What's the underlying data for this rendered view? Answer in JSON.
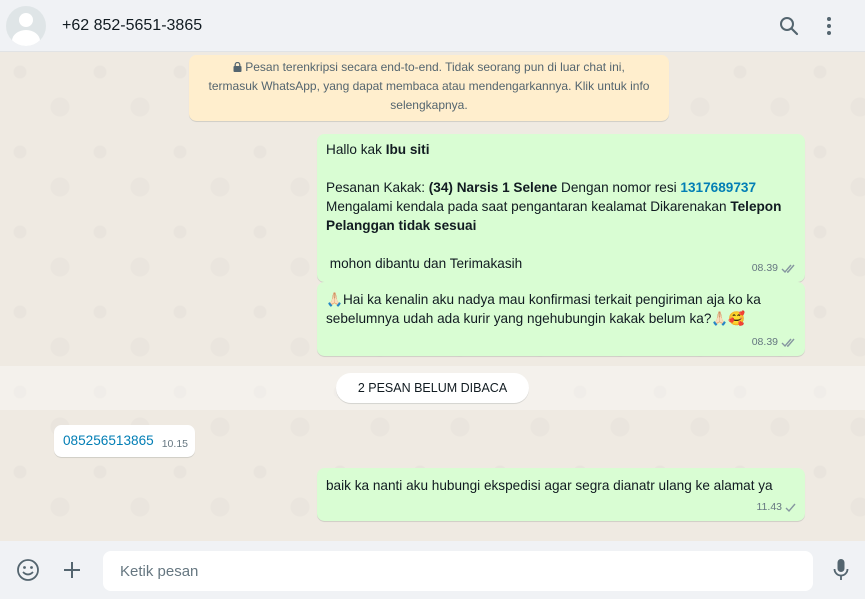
{
  "header": {
    "contact_name": "+62 852-5651-3865",
    "icons": [
      "search-icon",
      "menu-dots-icon"
    ]
  },
  "encryption_notice": {
    "line1": "Pesan terenkripsi secara end-to-end. Tidak seorang pun di luar chat ini,",
    "line2": "termasuk WhatsApp, yang dapat membaca atau mendengarkannya. Klik untuk info",
    "line3": "selengkapnya."
  },
  "messages": [
    {
      "direction": "outgoing",
      "greeting_prefix": "Hallo kak ",
      "greeting_name": "Ibu siti",
      "order_prefix": "Pesanan Kakak: ",
      "order_item": "(34) Narsis 1 Selene",
      "order_middle": " Dengan nomor resi ",
      "receipt_number": "1317689737",
      "issue_text": "Mengalami kendala pada saat pengantaran kealamat Dikarenakan ",
      "issue_bold_1": "Telepon",
      "issue_bold_2": "Pelanggan tidak sesuai",
      "closing": " mohon dibantu dan Terimakasih",
      "time": "08.39",
      "status": "double-check"
    },
    {
      "direction": "outgoing",
      "emoji_start": "🙏🏻",
      "line1": "Hai ka kenalin aku nadya mau konfirmasi terkait pengiriman aja ko ka",
      "line2": "sebelumnya udah ada kurir yang ngehubungin kakak belum ka?",
      "emoji_end": "🙏🏻🥰",
      "time": "08.39",
      "status": "double-check"
    },
    {
      "direction": "incoming",
      "text": "085256513865",
      "time": "10.15"
    },
    {
      "direction": "outgoing",
      "text": "baik ka nanti aku hubungi ekspedisi agar segra dianatr ulang ke alamat ya",
      "time": "11.43",
      "status": "single-check"
    }
  ],
  "unread_divider": "2 PESAN BELUM DIBACA",
  "composer": {
    "placeholder": "Ketik pesan",
    "icons": [
      "emoji-icon",
      "plus-icon",
      "mic-icon"
    ]
  },
  "colors": {
    "outgoing_bubble": "#d9fdd3",
    "incoming_bubble": "#ffffff",
    "notice_bg": "#ffeecd",
    "link": "#027eb5",
    "chat_bg": "#efeae2"
  }
}
